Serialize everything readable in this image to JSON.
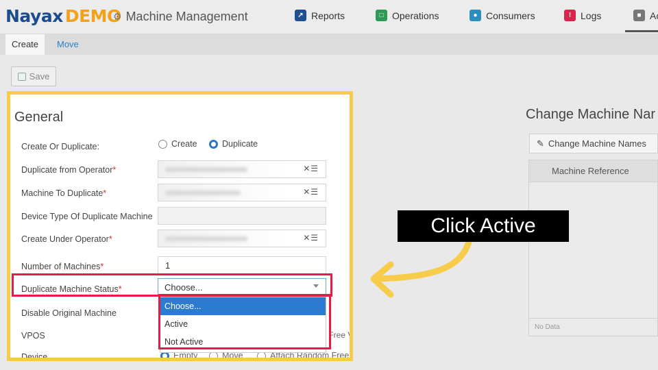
{
  "header": {
    "logo_brand": "Nayax",
    "logo_demo": "DEMO",
    "title": "Machine Management",
    "nav": [
      {
        "label": "Reports",
        "icon": "chart-icon",
        "color": "#1f4f8f"
      },
      {
        "label": "Operations",
        "icon": "operations-icon",
        "color": "#2d9a55"
      },
      {
        "label": "Consumers",
        "icon": "consumers-icon",
        "color": "#2a8fbf"
      },
      {
        "label": "Logs",
        "icon": "logs-icon",
        "color": "#d8264b"
      },
      {
        "label": "Ac",
        "icon": "admin-icon",
        "color": "#777777"
      }
    ]
  },
  "tabs": {
    "create": "Create",
    "move": "Move"
  },
  "toolbar": {
    "save_label": "Save"
  },
  "form": {
    "title": "General",
    "create_or_duplicate": {
      "label": "Create Or Duplicate:",
      "options": [
        "Create",
        "Duplicate"
      ],
      "selected": "Duplicate"
    },
    "duplicate_from_operator": {
      "label": "Duplicate from Operator"
    },
    "machine_to_duplicate": {
      "label": "Machine To Duplicate"
    },
    "device_type": {
      "label": "Device Type Of Duplicate Machine"
    },
    "create_under_operator": {
      "label": "Create Under Operator"
    },
    "number_of_machines": {
      "label": "Number of Machines",
      "value": "1"
    },
    "duplicate_status": {
      "label": "Duplicate Machine Status",
      "value": "Choose...",
      "options": [
        "Choose...",
        "Active",
        "Not Active"
      ]
    },
    "disable_original": {
      "label": "Disable Original Machine"
    },
    "vpos": {
      "label": "VPOS",
      "behind_text": "r Free Vpos"
    },
    "device": {
      "label": "Device",
      "options": [
        "Empty",
        "Move",
        "Attach Random Free Device"
      ]
    }
  },
  "right_panel": {
    "title": "Change Machine Nar",
    "button_label": "Change Machine Names",
    "column_header": "Machine Reference",
    "empty_text": "No Data"
  },
  "annotation": {
    "callout": "Click Active",
    "highlight_color": "#e51c47",
    "frame_color": "#f8cc4b",
    "arrow_color": "#f8cc4b"
  }
}
